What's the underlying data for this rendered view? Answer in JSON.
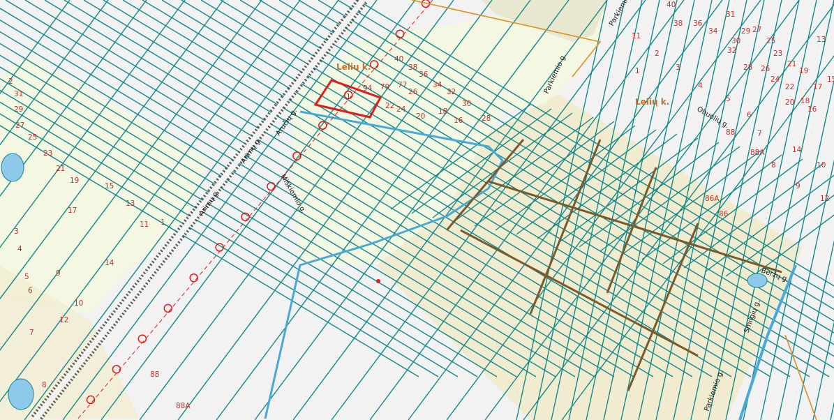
{
  "map": {
    "title": "",
    "place_labels": [
      {
        "text": "Lelių k.",
        "id": "place-leliu-1"
      },
      {
        "text": "Lelių k.",
        "id": "place-leliu-2"
      }
    ],
    "streets": [
      {
        "text": "Arimų g.",
        "id": "street-arimu-1"
      },
      {
        "text": "Arimų g.",
        "id": "street-arimu-2"
      },
      {
        "text": "Aručių g.",
        "id": "street-aruciu"
      },
      {
        "text": "Miškiemio g.",
        "id": "street-miskiemio-1"
      },
      {
        "text": "Parkiemio g.",
        "id": "street-parkiemio-1"
      },
      {
        "text": "Parkiemio g.",
        "id": "street-parkiemio-2"
      },
      {
        "text": "Obuolių g.",
        "id": "street-obuoliu"
      },
      {
        "text": "Parkiemio g.",
        "id": "street-parkiemio-3"
      },
      {
        "text": "Smilgių g.",
        "id": "street-smilgiu"
      },
      {
        "text": "Beržų g.",
        "id": "street-berzu"
      }
    ],
    "parcel_numbers": [
      "40",
      "38",
      "36",
      "34",
      "32",
      "30",
      "28",
      "26",
      "24",
      "22",
      "20",
      "18",
      "16",
      "31",
      "29",
      "27",
      "25",
      "23",
      "21",
      "19",
      "17",
      "15",
      "13",
      "11",
      "1",
      "2",
      "3",
      "4",
      "5",
      "6",
      "7",
      "8",
      "9",
      "10",
      "12",
      "14",
      "88",
      "88A",
      "86A",
      "86",
      "94",
      "79",
      "77"
    ],
    "colors": {
      "background": "#f2f2f2",
      "parcel_outline": "#0f8a8a",
      "parcel_number": "#c0302f",
      "place_label": "#c8702a",
      "selected_parcel": "#e01b1b",
      "water": "#4aa8d8",
      "road_border": "#555555",
      "settlement_fill": "#f1ecd0",
      "green_fill": "#f4f8dc"
    },
    "selected_parcel_number": "1"
  }
}
